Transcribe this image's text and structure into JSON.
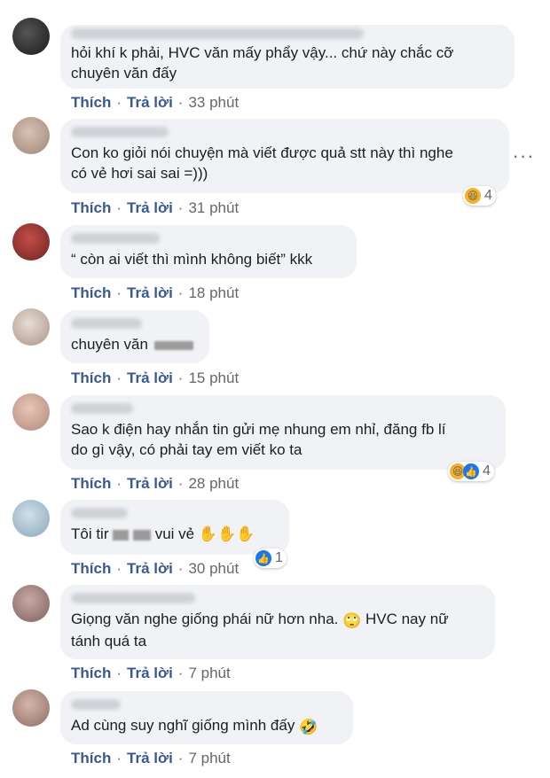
{
  "actions": {
    "like": "Thích",
    "reply": "Trả lời",
    "separator": "·"
  },
  "comments": [
    {
      "text": "hỏi khí k phải, HVC văn mấy phẩy vậy... chứ này chắc cỡ\nchuyên văn đấy",
      "time": "33 phút"
    },
    {
      "text": "Con ko giỏi nói chuyện mà viết được quả stt này thì nghe\ncó vẻ hơi sai sai =)))",
      "time": "31 phút",
      "reaction_count": "4",
      "reactions": [
        "haha-icon"
      ]
    },
    {
      "text": "“ còn ai viết thì mình không biết” kkk",
      "time": "18 phút"
    },
    {
      "text": "chuyên văn",
      "time": "15 phút"
    },
    {
      "text": "Sao k điện hay nhắn tin gửi mẹ nhung em nhỉ, đăng fb lí\ndo gì vậy, có phải tay em viết ko ta",
      "time": "28 phút",
      "reaction_count": "4",
      "reactions": [
        "haha-icon",
        "like-icon"
      ]
    },
    {
      "text_before": "Tôi tir",
      "text_after": "vui vẻ",
      "emojis": "✋✋✋",
      "time": "30 phút",
      "reaction_count": "1",
      "reactions": [
        "like-icon"
      ]
    },
    {
      "text": "Giọng văn nghe giống phái nữ hơn nha. ",
      "text2": " HVC nay nữ\ntánh quá ta",
      "time": "7 phút"
    },
    {
      "text": "Ad cùng suy nghĩ giống mình đấy ",
      "time": "7 phút"
    }
  ],
  "colors": {
    "bubble": "#f0f2f5",
    "link": "#385898",
    "meta": "#65676b",
    "like": "#1877f2",
    "haha": "#f7b125"
  }
}
